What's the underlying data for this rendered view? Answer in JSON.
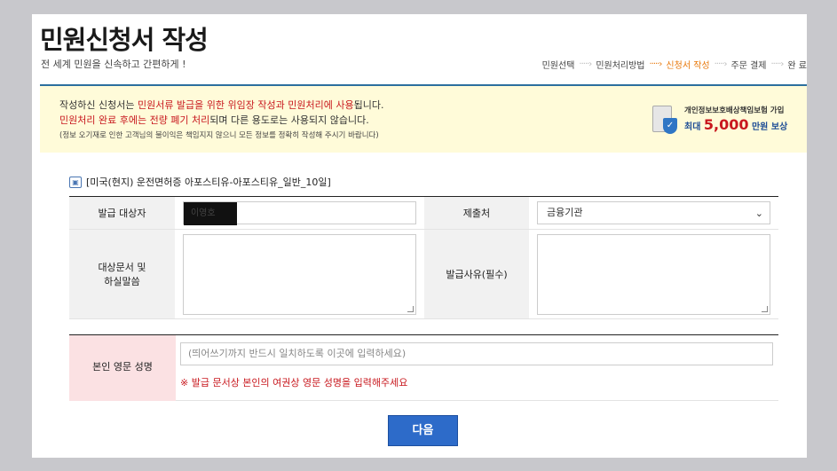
{
  "header": {
    "title": "민원신청서 작성",
    "subtitle": "전 세계 민원을 신속하고 간편하게 !"
  },
  "steps": [
    {
      "label": "민원선택",
      "active": false
    },
    {
      "label": "민원처리방법",
      "active": false
    },
    {
      "label": "신청서 작성",
      "active": true
    },
    {
      "label": "주문 결제",
      "active": false
    },
    {
      "label": "완 료",
      "active": false
    }
  ],
  "notice": {
    "line1_prefix": "작성하신 신청서는 ",
    "line1_red": "민원서류 발급을 위한 위임장 작성과 민원처리에 사용",
    "line1_suffix": "됩니다.",
    "line2_red": "민원처리 완료 후에는 전량 폐기 처리",
    "line2_suffix": "되며 다른 용도로는 사용되지 않습니다.",
    "line3": "(정보 오기재로 인한 고객님의 불이익은 책임지지 않으니 모든 정보를 정확히 작성해 주시기 바랍니다)"
  },
  "insurance_badge": {
    "line1": "개인정보보호배상책임보험 가입",
    "prefix": "최대 ",
    "amount": "5,000",
    "suffix": " 만원 보상"
  },
  "product_title": "[미국(현지) 운전면허증 아포스티유-아포스티유_일반_10일]",
  "form": {
    "recipient_label": "발급 대상자",
    "recipient_value": "이영호",
    "submit_to_label": "제출처",
    "submit_to_value": "금융기관",
    "docs_label": "대상문서 및 하실말씀",
    "reason_label": "발급사유(필수)"
  },
  "english_name": {
    "label": "본인 영문 성명",
    "placeholder": "(띄어쓰기까지 반드시 일치하도록 이곳에 입력하세요)",
    "warning": "※ 발급 문서상 본인의 여권상 영문 성명을 입력해주세요"
  },
  "next_button": "다음",
  "colors": {
    "accent": "#2d6bc9",
    "active_step": "#e8780a",
    "warning": "#c8181e",
    "notice_bg": "#fffbd9"
  }
}
